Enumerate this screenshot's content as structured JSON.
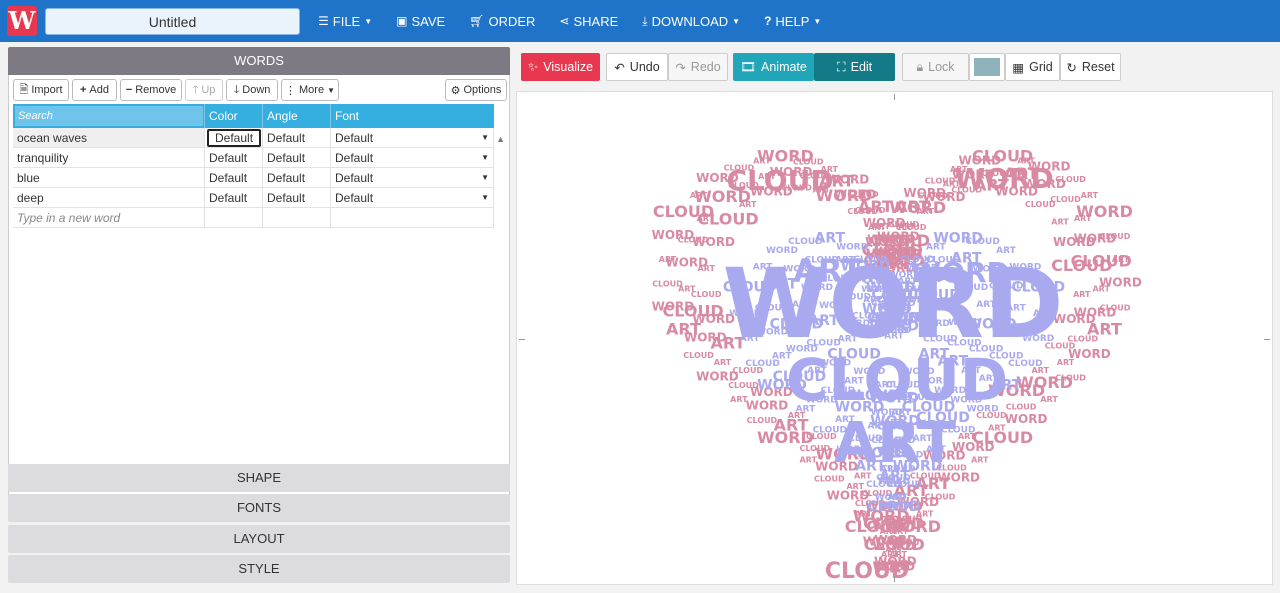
{
  "app": {
    "logo_letter": "W",
    "title_value": "Untitled"
  },
  "nav": [
    {
      "label": "FILE",
      "icon": "≡",
      "caret": true
    },
    {
      "label": "SAVE",
      "icon": "▣",
      "caret": false
    },
    {
      "label": "ORDER",
      "icon": "⛟",
      "caret": false
    },
    {
      "label": "SHARE",
      "icon": "⟨",
      "caret": false
    },
    {
      "label": "DOWNLOAD",
      "icon": "⤓",
      "caret": true
    },
    {
      "label": "HELP",
      "icon": "?",
      "caret": true
    }
  ],
  "words_panel": {
    "header": "WORDS",
    "toolbar": {
      "import": "Import",
      "add": "Add",
      "remove": "Remove",
      "up": "Up",
      "down": "Down",
      "more": "More",
      "options": "Options"
    },
    "columns": {
      "search_placeholder": "Search",
      "color": "Color",
      "angle": "Angle",
      "font": "Font"
    },
    "rows": [
      {
        "word": "ocean waves",
        "color": "Default",
        "angle": "Default",
        "font": "Default"
      },
      {
        "word": "tranquility",
        "color": "Default",
        "angle": "Default",
        "font": "Default"
      },
      {
        "word": "blue",
        "color": "Default",
        "angle": "Default",
        "font": "Default"
      },
      {
        "word": "deep",
        "color": "Default",
        "angle": "Default",
        "font": "Default"
      }
    ],
    "new_word_placeholder": "Type in a new word"
  },
  "sections": {
    "shape": "SHAPE",
    "fonts": "FONTS",
    "layout": "LAYOUT",
    "style": "STYLE"
  },
  "canvas_toolbar": {
    "visualize": "Visualize",
    "undo": "Undo",
    "redo": "Redo",
    "animate": "Animate",
    "edit": "Edit",
    "lock": "Lock",
    "grid": "Grid",
    "reset": "Reset",
    "swatch_color": "#8fb3bb"
  },
  "cloud": {
    "outer_color": "#d98aa3",
    "inner_color": "#a9a9ef",
    "big_words": [
      "WORD",
      "CLOUD",
      "ART"
    ],
    "filler_words": [
      "WORD",
      "CLOUD",
      "ART"
    ]
  }
}
